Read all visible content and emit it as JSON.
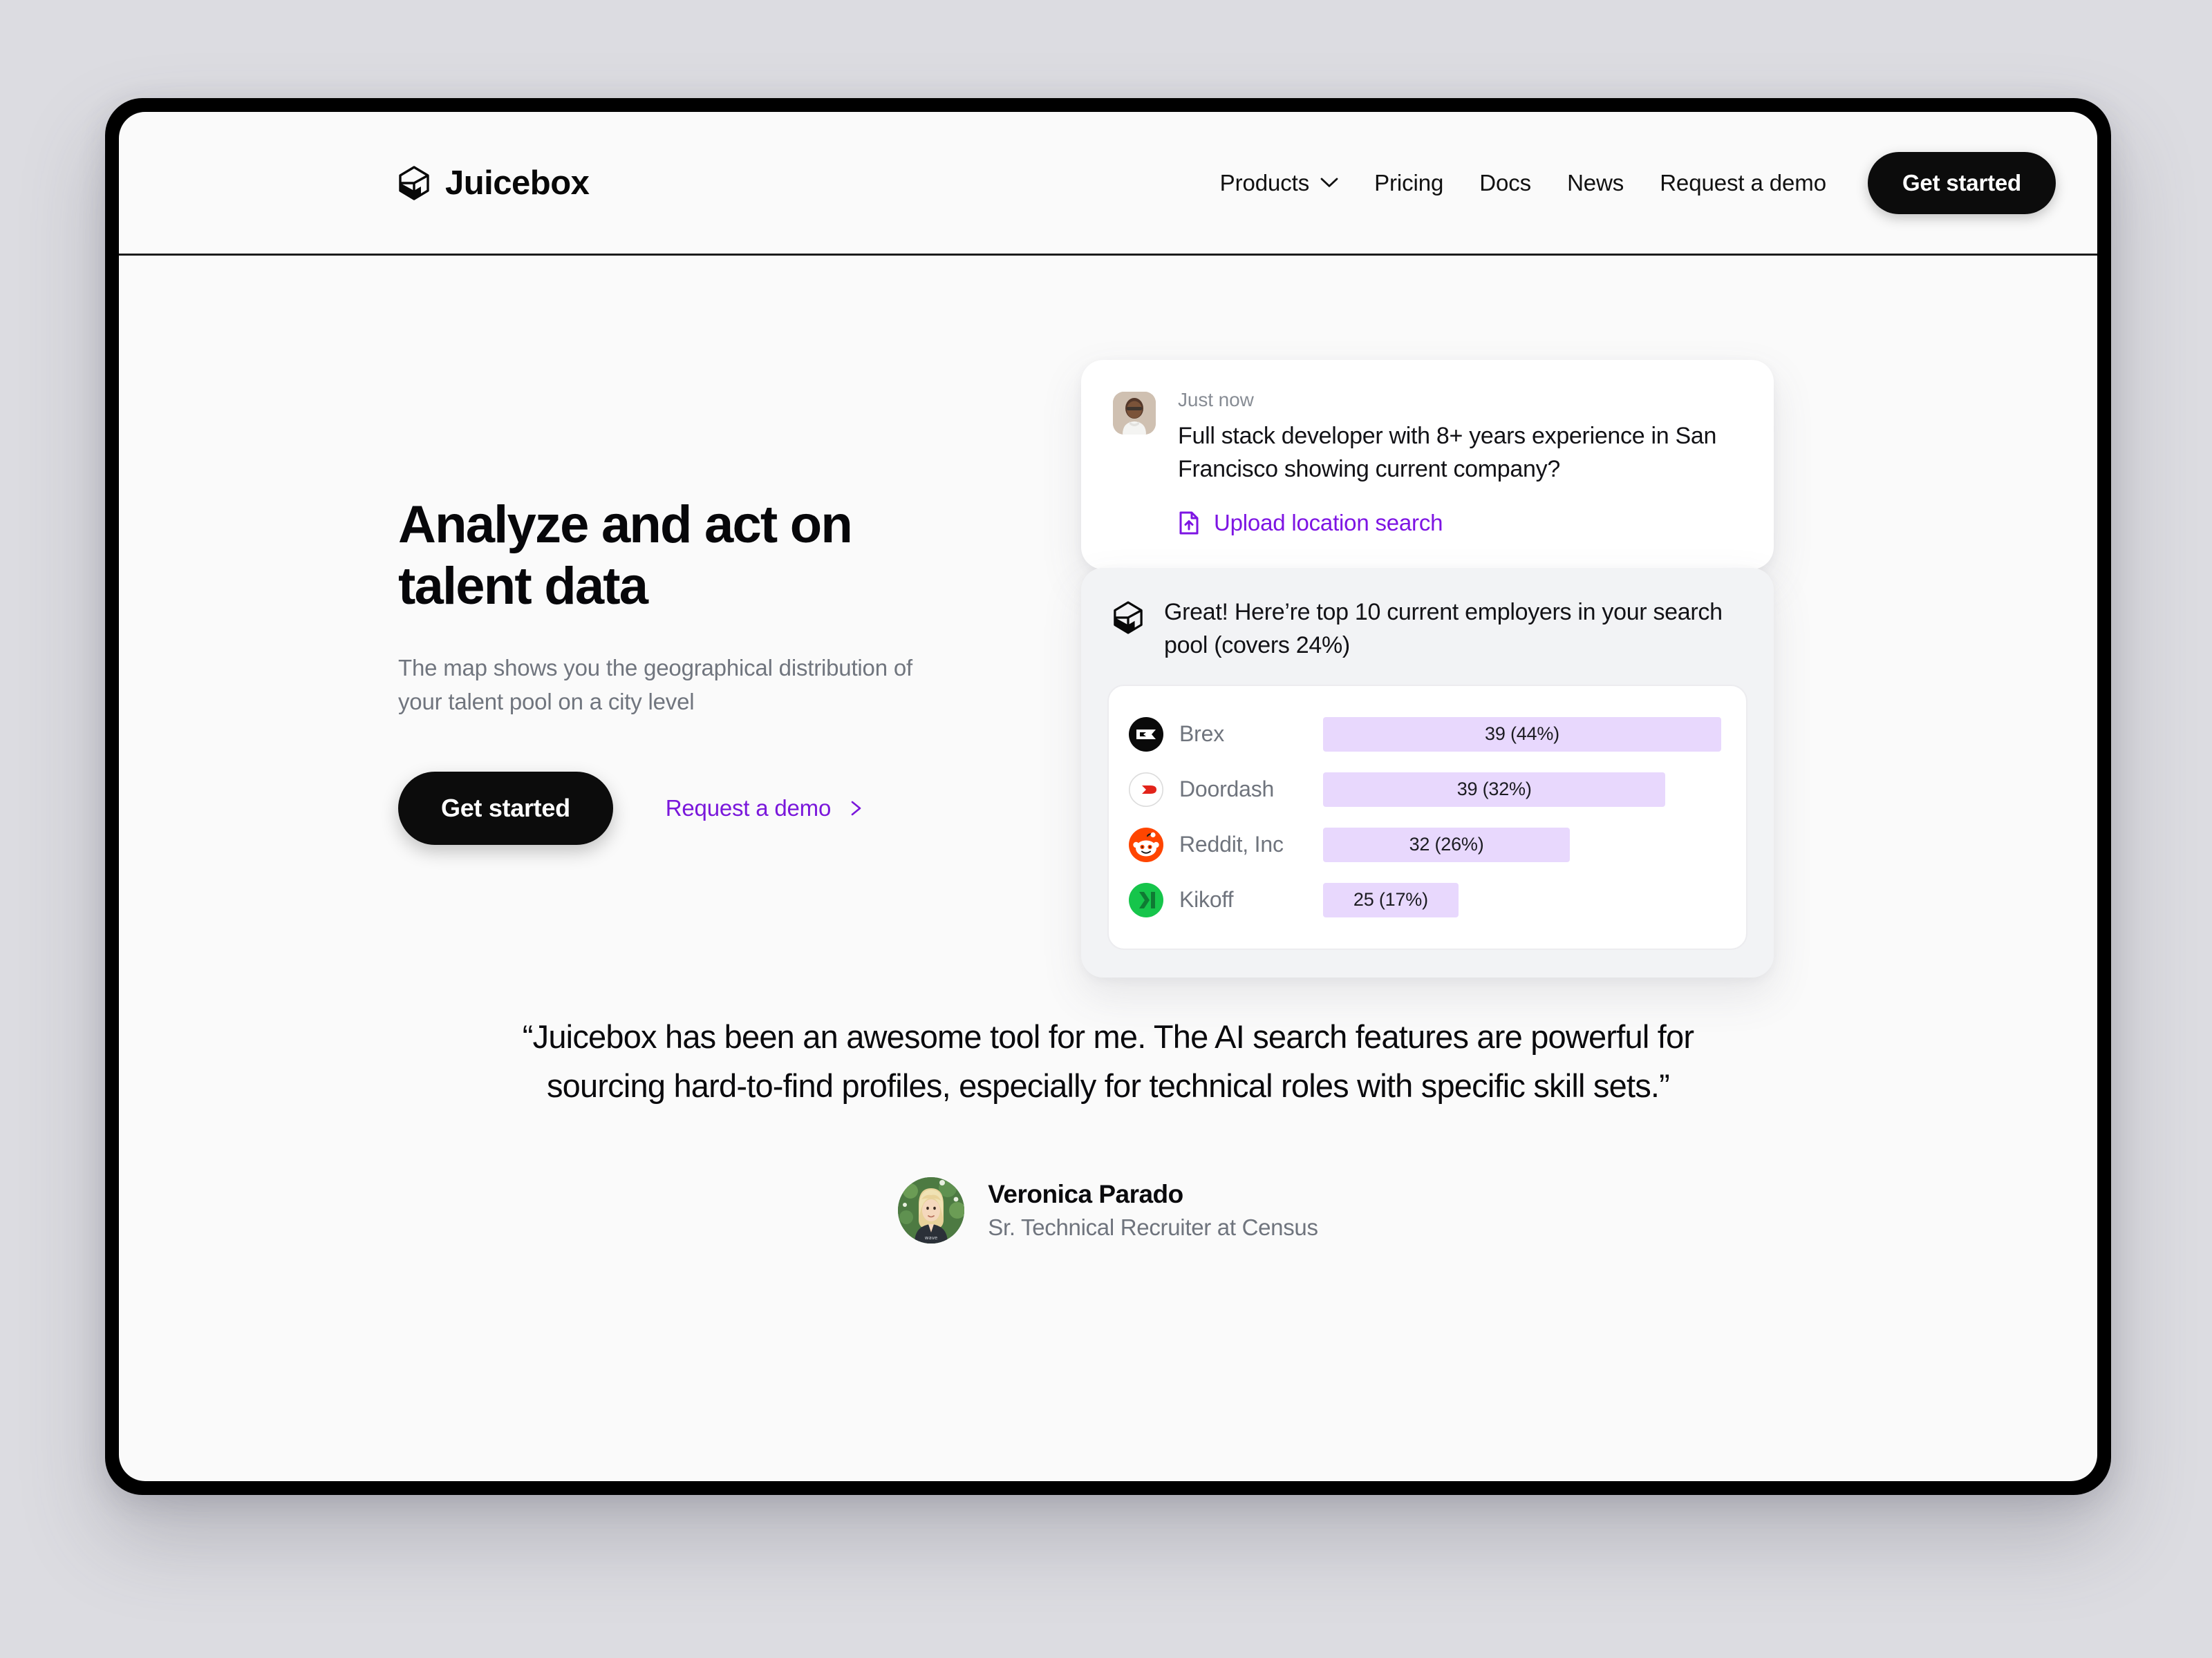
{
  "header": {
    "brand": "Juicebox",
    "brand_icon": "cube-logo-icon",
    "nav": [
      {
        "label": "Products",
        "has_chevron": true,
        "icon": "chevron-down-icon"
      },
      {
        "label": "Pricing",
        "has_chevron": false
      },
      {
        "label": "Docs",
        "has_chevron": false
      },
      {
        "label": "News",
        "has_chevron": false
      },
      {
        "label": "Request a demo",
        "has_chevron": false
      }
    ],
    "cta": "Get started"
  },
  "hero": {
    "title_line1": "Analyze and act on",
    "title_line2": "talent data",
    "subtitle": "The map shows you the geographical distribution of your talent pool on a city level",
    "primary_cta": "Get started",
    "secondary_cta": "Request a demo",
    "secondary_icon": "arrow-right-icon"
  },
  "query_card": {
    "avatar": "user-photo-avatar",
    "timestamp": "Just now",
    "text": "Full stack developer with 8+ years experience in San Francisco showing current company?",
    "upload_label": "Upload location search",
    "upload_icon": "file-upload-icon"
  },
  "answer_card": {
    "logo_icon": "cube-logo-icon",
    "text": "Great! Here’re top 10 current employers in your search pool (covers 24%)"
  },
  "chart_data": {
    "type": "bar",
    "title": "Top 10 current employers in your search pool (covers 24%)",
    "orientation": "horizontal",
    "categories": [
      "Brex",
      "Doordash",
      "Reddit, Inc",
      "Kikoff"
    ],
    "values": [
      39,
      39,
      32,
      25
    ],
    "percents": [
      44,
      32,
      26,
      17
    ],
    "labels": [
      "39 (44%)",
      "39 (32%)",
      "32 (26%)",
      "25 (17%)"
    ],
    "bar_widths_pct": [
      100,
      86,
      62,
      34
    ],
    "bar_color": "#e8d8fd",
    "logos": [
      "brex-logo-icon",
      "doordash-logo-icon",
      "reddit-logo-icon",
      "kikoff-logo-icon"
    ],
    "xlabel": "",
    "ylabel": "",
    "grid": false,
    "legend": "none"
  },
  "testimonial": {
    "quote": "“Juicebox has been an awesome tool for me. The AI search features are powerful for sourcing hard-to-find profiles, especially for technical roles with specific skill sets.”",
    "author_name": "Veronica Parado",
    "author_role": "Sr. Technical Recruiter at Census",
    "author_avatar": "veronica-photo-avatar"
  },
  "colors": {
    "accent_purple": "#7d14e3",
    "bar_lavender": "#e8d8fd",
    "page_background": "#dcdce1",
    "screen_background": "#fafafa",
    "frame_black": "#000000"
  }
}
